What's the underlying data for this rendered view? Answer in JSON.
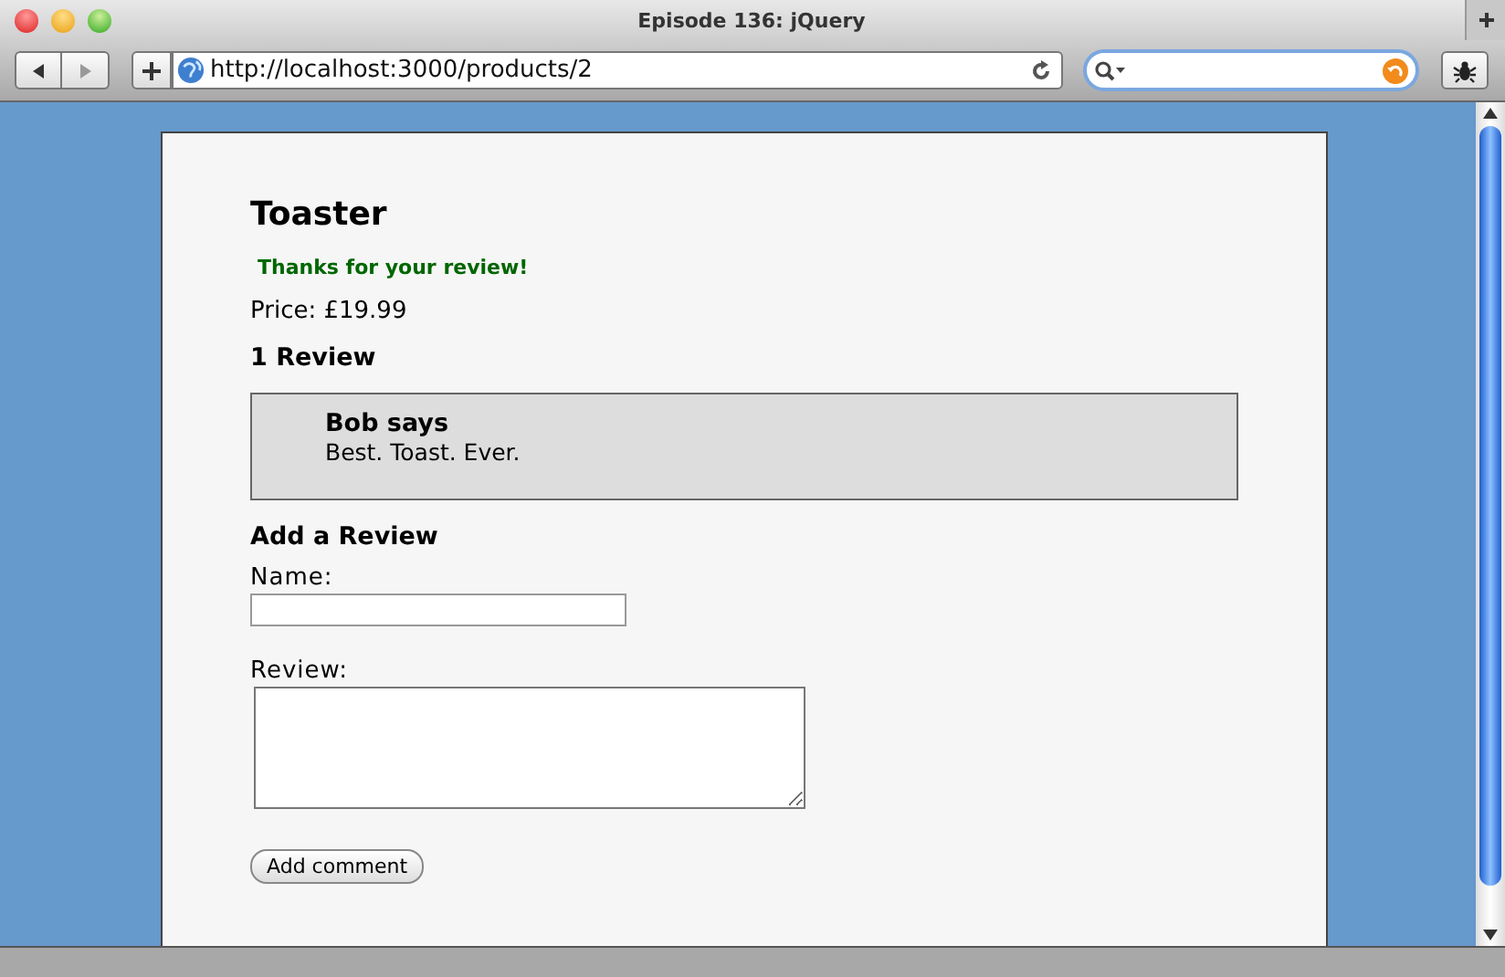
{
  "window": {
    "title": "Episode 136: jQuery"
  },
  "toolbar": {
    "url": "http://localhost:3000/products/2"
  },
  "page": {
    "title": "Toaster",
    "notice": "Thanks for your review!",
    "price_label": "Price:",
    "price": "£19.99",
    "reviews_heading": "1 Review",
    "reviews": [
      {
        "author": "Bob says",
        "body": "Best. Toast. Ever."
      }
    ],
    "form_heading": "Add a Review",
    "name_label": "Name:",
    "review_label": "Review:",
    "submit": "Add comment"
  }
}
